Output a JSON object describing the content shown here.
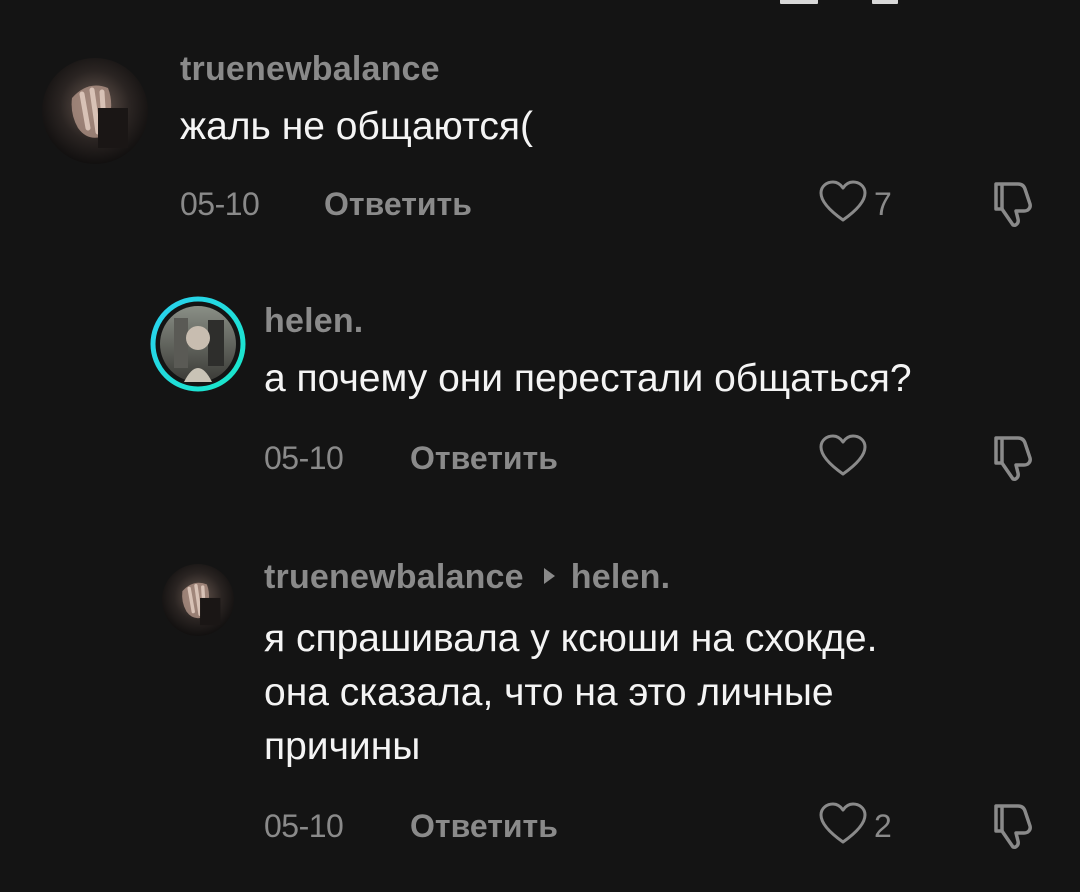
{
  "comments": [
    {
      "username": "truenewbalance",
      "text": "жаль не общаются(",
      "date": "05-10",
      "reply_label": "Ответить",
      "like_count": "7"
    },
    {
      "username": "helen.",
      "text": "а почему они перестали общаться?",
      "date": "05-10",
      "reply_label": "Ответить",
      "like_count": ""
    },
    {
      "username": "truenewbalance",
      "reply_to": "helen.",
      "text_lines": [
        "я спрашивала у ксюши на схокде.",
        "она сказала, что на это личные",
        "причины"
      ],
      "date": "05-10",
      "reply_label": "Ответить",
      "like_count": "2"
    }
  ],
  "icons": {
    "like": "heart-outline-icon",
    "dislike": "thumbs-down-outline-icon",
    "reply_arrow": "triangle-right-icon"
  },
  "colors": {
    "background": "#141414",
    "secondary_text": "#8a8a8a",
    "primary_text": "#f4f4f4",
    "story_ring_start": "#2ad0f0",
    "story_ring_end": "#18e8c8"
  }
}
